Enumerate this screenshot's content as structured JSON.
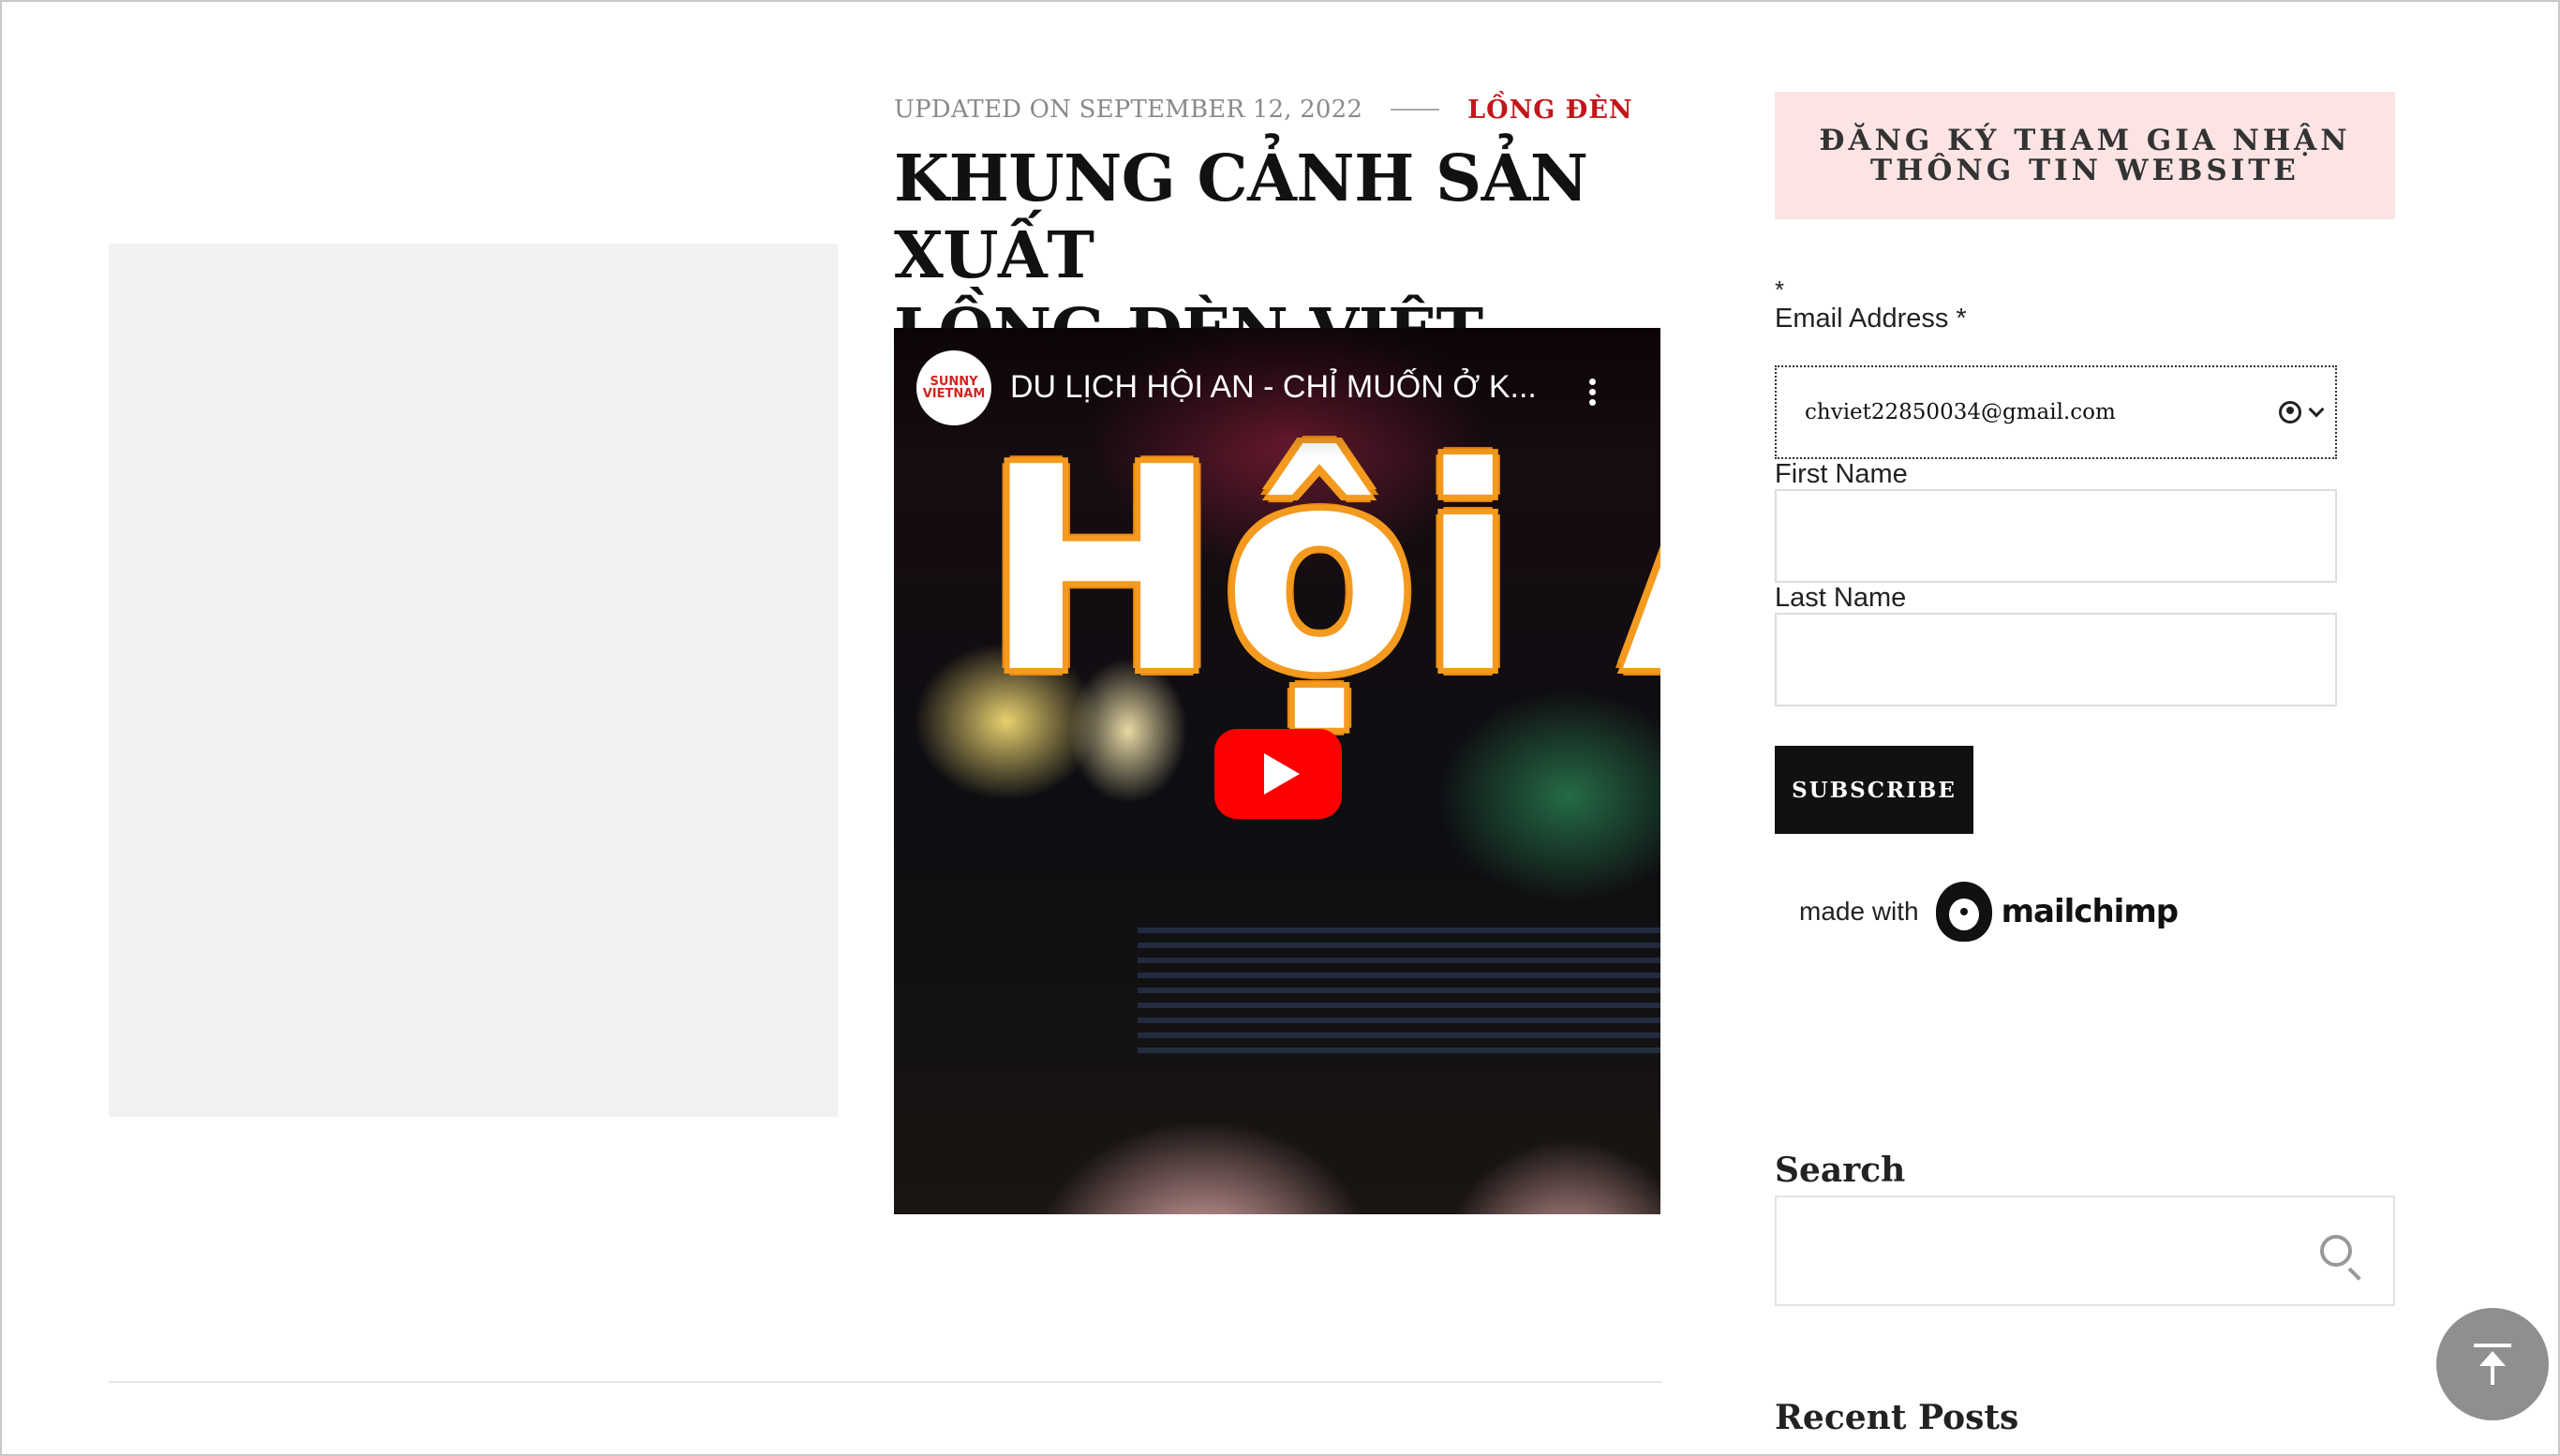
{
  "post": {
    "updated": "UPDATED ON SEPTEMBER 12, 2022",
    "category": "LỒNG ĐÈN",
    "title_line1": "KHUNG CẢNH SẢN XUẤT",
    "title_line2": "LỒNG ĐÈN VIỆT"
  },
  "video": {
    "channel_logo_text": "SUNNY VIETNAM",
    "title": "DU LỊCH HỘI AN - CHỈ MUỐN Ở K...",
    "overlay_text": "Hội An"
  },
  "newsletter": {
    "heading": "ĐĂNG KÝ THAM GIA NHẬN THÔNG TIN WEBSITE",
    "required_note": "*",
    "email_label": "Email Address *",
    "email_value": "chviet22850034@gmail.com",
    "first_name_label": "First Name",
    "last_name_label": "Last Name",
    "subscribe_label": "SUBSCRIBE",
    "made_with": "made with",
    "brand": "mailchimp"
  },
  "sidebar": {
    "search_title": "Search",
    "recent_posts_title": "Recent Posts"
  },
  "colors": {
    "accent": "#c2161b",
    "newsletter_bg": "#fce4e4",
    "youtube_red": "#ff0000"
  }
}
